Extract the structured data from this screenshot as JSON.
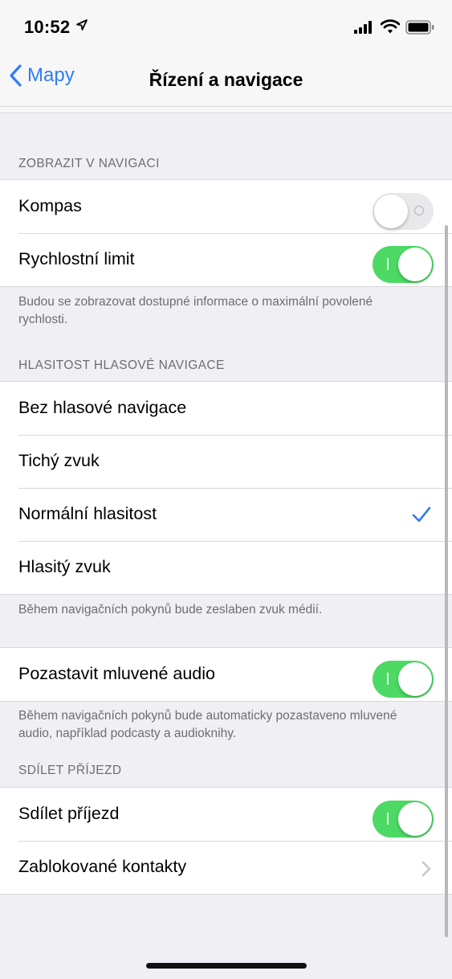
{
  "status_bar": {
    "time": "10:52"
  },
  "nav": {
    "back_label": "Mapy",
    "title": "Řízení a navigace"
  },
  "sections": {
    "display": {
      "header": "ZOBRAZIT V NAVIGACI",
      "rows": [
        {
          "label": "Kompas",
          "toggle": "off"
        },
        {
          "label": "Rychlostní limit",
          "toggle": "on"
        }
      ],
      "footer": "Budou se zobrazovat dostupné informace o maximální povolené rychlosti."
    },
    "volume": {
      "header": "HLASITOST HLASOVÉ NAVIGACE",
      "rows": [
        {
          "label": "Bez hlasové navigace",
          "selected": false
        },
        {
          "label": "Tichý zvuk",
          "selected": false
        },
        {
          "label": "Normální hlasitost",
          "selected": true
        },
        {
          "label": "Hlasitý zvuk",
          "selected": false
        }
      ],
      "footer": "Během navigačních pokynů bude zeslaben zvuk médií."
    },
    "audio": {
      "rows": [
        {
          "label": "Pozastavit mluvené audio",
          "toggle": "on"
        }
      ],
      "footer": "Během navigačních pokynů bude automaticky pozastaveno mluvené audio, například podcasty a audioknihy."
    },
    "share": {
      "header": "SDÍLET PŘÍJEZD",
      "rows": [
        {
          "label": "Sdílet příjezd",
          "toggle": "on"
        },
        {
          "label": "Zablokované kontakty"
        }
      ]
    }
  },
  "icons": {
    "location": "location-arrow-icon",
    "signal": "cellular-signal-icon",
    "wifi": "wifi-icon",
    "battery": "battery-icon",
    "back": "chevron-left-icon",
    "check": "checkmark-icon",
    "disclosure": "chevron-right-icon"
  },
  "colors": {
    "accent": "#2f7cf6",
    "toggle_on": "#4cd964",
    "toggle_off": "#e9e9eb",
    "background": "#efeff4"
  }
}
